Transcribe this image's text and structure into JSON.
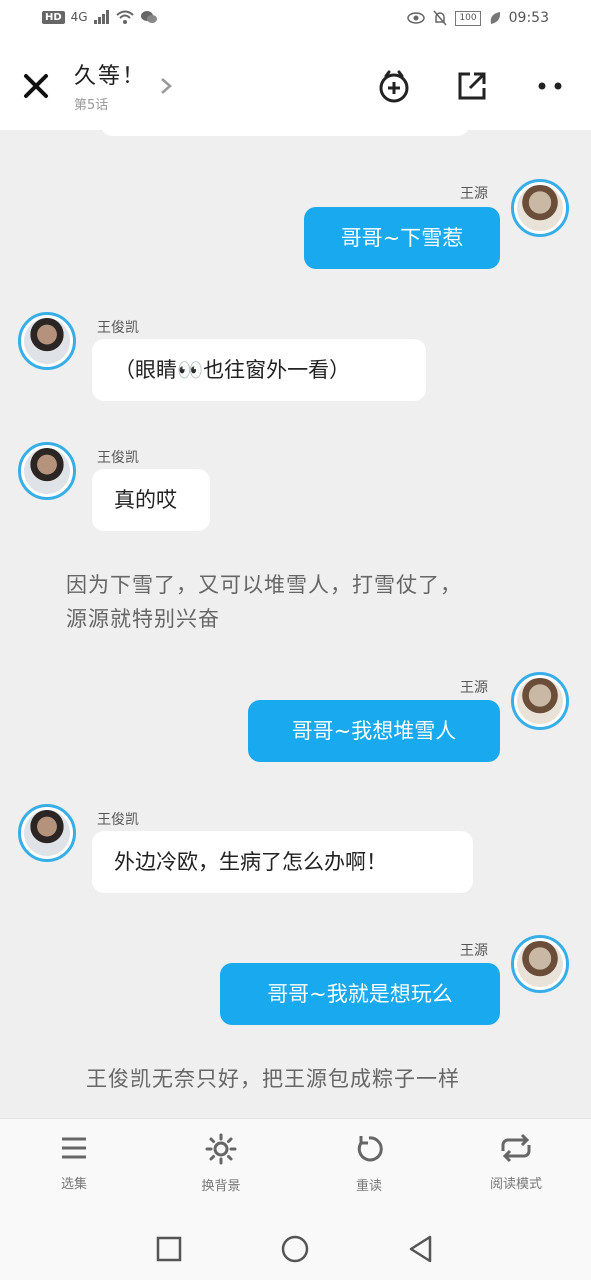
{
  "status_bar": {
    "left_badge": "HD",
    "network": "4G",
    "battery": "100",
    "time": "09:53"
  },
  "header": {
    "title": "久等！",
    "subtitle": "第5话"
  },
  "messages": [
    {
      "speaker": "王源",
      "text": "哥哥~下雪惹"
    },
    {
      "speaker": "王俊凯",
      "text": "（眼睛👀也往窗外一看）"
    },
    {
      "speaker": "王俊凯",
      "text": "真的哎"
    },
    {
      "narration": [
        "因为下雪了，又可以堆雪人，打雪仗了，",
        "源源就特别兴奋"
      ]
    },
    {
      "speaker": "王源",
      "text": "哥哥~我想堆雪人"
    },
    {
      "speaker": "王俊凯",
      "text": "外边冷欧，生病了怎么办啊！"
    },
    {
      "speaker": "王源",
      "text": "哥哥~我就是想玩么"
    },
    {
      "narration": [
        "王俊凯无奈只好，把王源包成粽子一样"
      ]
    }
  ],
  "toolbar": {
    "items": [
      {
        "label": "选集",
        "icon": "menu-icon"
      },
      {
        "label": "换背景",
        "icon": "sun-icon"
      },
      {
        "label": "重读",
        "icon": "refresh-icon"
      },
      {
        "label": "阅读模式",
        "icon": "repeat-icon"
      }
    ]
  },
  "colors": {
    "accent": "#18a9ee",
    "avatar_ring": "#37aee8",
    "chat_background": "#efefef"
  }
}
